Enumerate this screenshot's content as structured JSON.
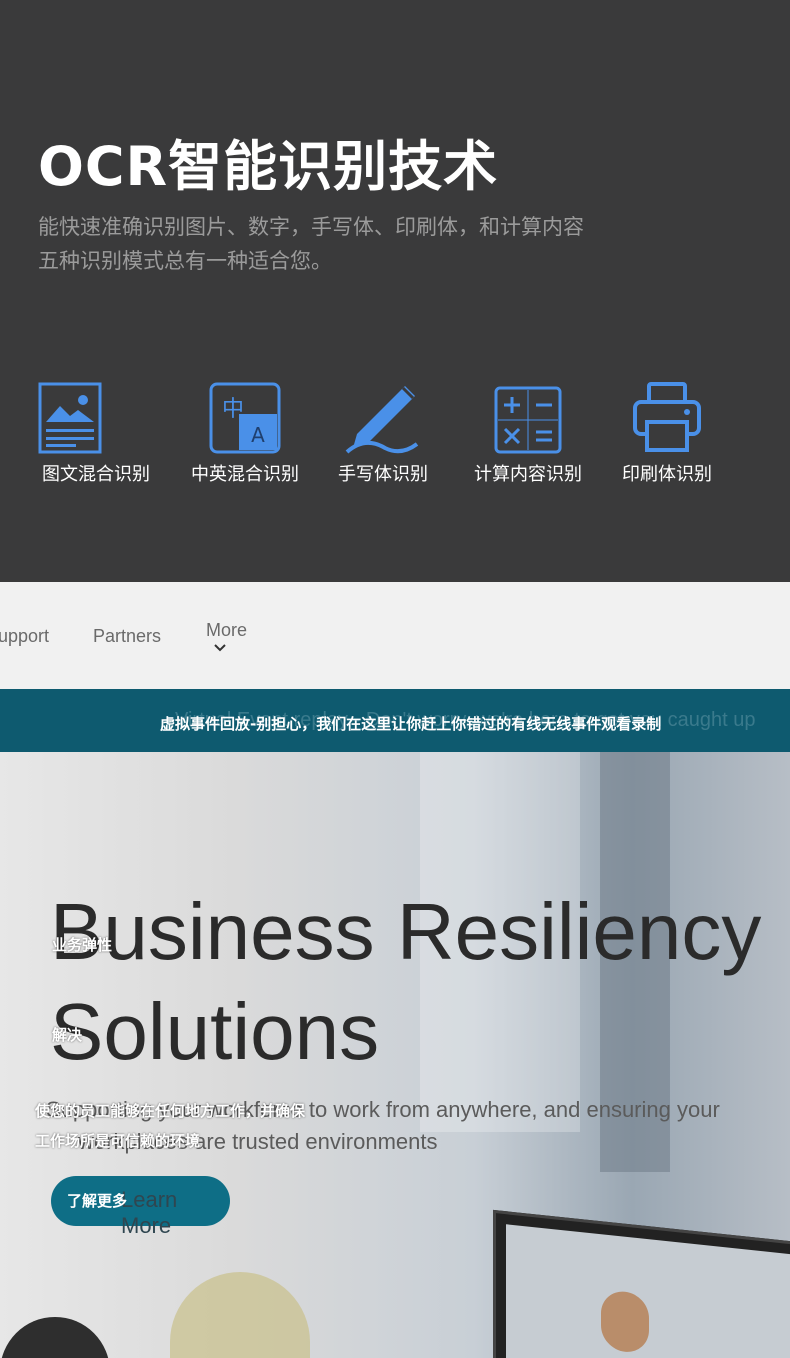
{
  "header": {
    "title": "OCR智能识别技术",
    "subtitle_lines": [
      "能快速准确识别图片、数字，手写体、印刷体，和计算内容",
      "五种识别模式总有一种适合您。"
    ]
  },
  "features": [
    {
      "label": "图文混合识别",
      "icon": "image-text-icon"
    },
    {
      "label": "中英混合识别",
      "icon": "chinese-english-icon"
    },
    {
      "label": "手写体识别",
      "icon": "pen-icon"
    },
    {
      "label": "计算内容识别",
      "icon": "calculator-icon"
    },
    {
      "label": "印刷体识别",
      "icon": "printer-icon"
    }
  ],
  "accent_color": "#4a90e8",
  "screenshot": {
    "nav": [
      "upport",
      "Partners",
      "More"
    ],
    "banner_bg": "Virtual Event replay - Don't worry, we're here to get you caught up",
    "banner_cn": "虚拟事件回放-别担心，我们在这里让你赶上你错过的有线无线事件观看录制",
    "hero_title_lines": [
      "Business Resiliency",
      "Solutions"
    ],
    "hero_sub_lines": [
      "Supporting your workforce to work from anywhere, and ensuring your",
      "workplaces are trusted environments"
    ],
    "overlay_cn": {
      "title1": "业务弹性",
      "title2": "解决",
      "sub1": "使您的员工能够在任何地方工作，并确保",
      "sub2": "工作场所是可信赖的环境"
    },
    "button_en": "Learn More",
    "button_cn": "了解更多"
  }
}
